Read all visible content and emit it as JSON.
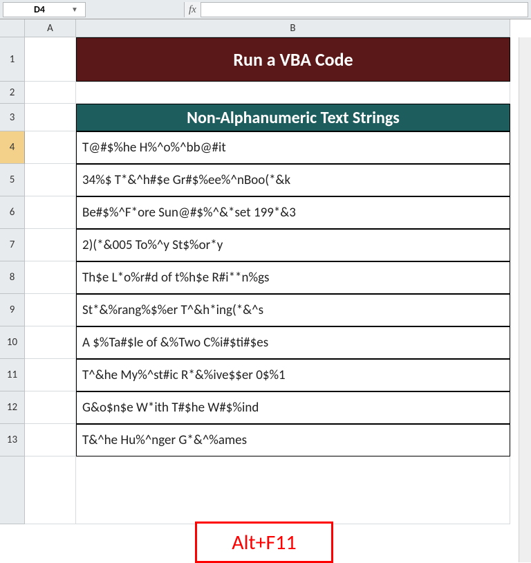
{
  "formula_bar": {
    "name_box": "D4",
    "fx_label": "fx",
    "formula_value": ""
  },
  "columns": {
    "A": "A",
    "B": "B"
  },
  "rows_labels": [
    "1",
    "2",
    "3",
    "4",
    "5",
    "6",
    "7",
    "8",
    "9",
    "10",
    "11",
    "12",
    "13"
  ],
  "title_cell": "Run a VBA Code",
  "table_header": "Non-Alphanumeric Text Strings",
  "data": [
    "T@#$%he H%^o%^bb@#it",
    "34%$ T*&^h#$e Gr#$%ee%^nBoo(*&k",
    "Be#$%^F*ore Sun@#$%^&*set 199*&3",
    "2)(*&005 To%^y St$%or*y",
    "Th$e L*o%r#d of t%h$e R#i**n%gs",
    "St*&%rang%$%er T^&h*ing(*&^s",
    "A $%Ta#$le of &%Two C%i#$ti#$es",
    "T^&he My%^st#ic R*&%ive$$er 0$%1",
    "G&o$n$e W*ith T#$he W#$%ind",
    "T&^he Hu%^nger G*&^%ames"
  ],
  "annotation": "Alt+F11",
  "selected_cell": "D4"
}
